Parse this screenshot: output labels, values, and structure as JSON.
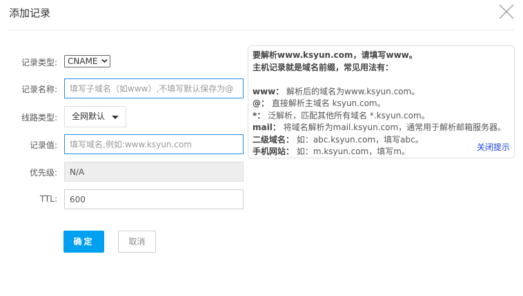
{
  "dialog": {
    "title": "添加记录"
  },
  "form": {
    "type_label": "记录类型:",
    "type_value": "CNAME",
    "name_label": "记录名称:",
    "name_placeholder": "填写子域名（如www）,不填写默认保存为@",
    "route_label": "线路类型:",
    "route_value": "全网默认",
    "value_label": "记录值:",
    "value_placeholder": "填写域名,例如:www.ksyun.com",
    "priority_label": "优先级:",
    "priority_value": "N/A",
    "ttl_label": "TTL:",
    "ttl_value": "600"
  },
  "tip": {
    "line1": "要解析www.ksyun.com，请填写www。",
    "line2": "主机记录就是域名前缀，常见用法有：",
    "items": [
      {
        "key": "www：",
        "text": " 解析后的域名为www.ksyun.com。"
      },
      {
        "key": "@：",
        "text": " 直接解析主域名 ksyun.com。"
      },
      {
        "key": "*：",
        "text": " 泛解析，匹配其他所有域名 *.ksyun.com。"
      },
      {
        "key": "mail：",
        "text": " 将域名解析为mail.ksyun.com，通常用于解析邮箱服务器。"
      },
      {
        "key": "二级域名：",
        "text": " 如：abc.ksyun.com，填写abc。"
      },
      {
        "key": "手机网站：",
        "text": " 如：m.ksyun.com，填写m。"
      }
    ],
    "close_label": "关闭提示"
  },
  "buttons": {
    "ok": "确定",
    "cancel": "取消"
  },
  "colors": {
    "primary": "#00a0f0",
    "focus_border": "#1e8fe1",
    "link": "#1a3fe0"
  }
}
